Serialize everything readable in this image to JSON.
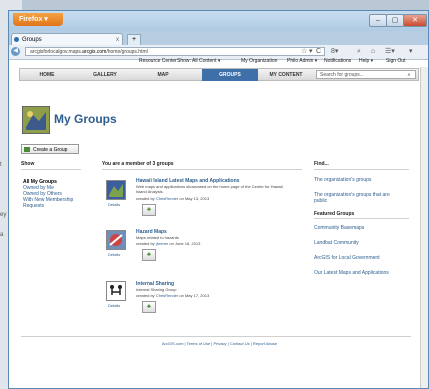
{
  "browser": {
    "menu_label": "Firefox ▾",
    "window_controls": [
      "–",
      "▢",
      "✕"
    ],
    "tab_title": "Groups",
    "tab_close": "x",
    "new_tab": "+",
    "url_host": "arcgisforlocalgov.maps.",
    "url_domain": "arcgis.com",
    "url_path": "/home/groups.html",
    "nav_icons": [
      "☆",
      "▾",
      "C",
      "8▾",
      "⌕",
      "⌂",
      "☰▾",
      "▾"
    ]
  },
  "topnav": {
    "resource_center": "Resource Center",
    "show_all": "Show: All Content ▾",
    "my_org": "My Organization",
    "user_admin": "Philo Admin ▾",
    "notifications": "Notifications",
    "help": "Help ▾",
    "sign_out": "Sign Out"
  },
  "mainnav": {
    "items": [
      "HOME",
      "GALLERY",
      "MAP",
      "GROUPS",
      "MY CONTENT"
    ],
    "active": "GROUPS",
    "search_placeholder": "Search for groups..."
  },
  "page": {
    "title": "My Groups",
    "create_button": "Create a Group",
    "show_heading": "Show",
    "member_heading": "You are a member of 3 groups",
    "find_heading": "Find..."
  },
  "show_items": [
    {
      "label": "All My Groups",
      "selected": true
    },
    {
      "label": "Owned by Me",
      "selected": false
    },
    {
      "label": "Owned by Others",
      "selected": false
    },
    {
      "label": "With New Membership Requests",
      "selected": false
    }
  ],
  "groups": [
    {
      "title": "Hawaii Island Latest Maps and Applications",
      "desc": "Web maps and applications showcased on the home page of the Center for Hawaii Island Analysis.",
      "created_prefix": "created by",
      "owner": "ChrisRender",
      "created_suffix": "on May 13, 2013",
      "details": "Details",
      "thumb_color": "#3a5ea0"
    },
    {
      "title": "Hazard Maps",
      "desc": "Maps related to hazards",
      "created_prefix": "created by",
      "owner": "jbrener",
      "created_suffix": "on June 18, 2013",
      "details": "Details",
      "thumb_color": "#6f8fb8"
    },
    {
      "title": "Internal Sharing",
      "desc": "Internal Sharing Group",
      "created_prefix": "created by",
      "owner": "ChrisRender",
      "created_suffix": "on May 17, 2013",
      "details": "Details",
      "thumb_color": "#ffffff"
    }
  ],
  "find": {
    "links": [
      "The organization's groups",
      "The organization's groups that are public"
    ],
    "featured_heading": "Featured Groups",
    "featured": [
      "Community Basemaps",
      "Landbat Community",
      "ArcGIS for Local Government",
      "Our Latest Maps and Applications"
    ]
  },
  "footer": {
    "links": [
      "ArcGIS.com",
      "Terms of Use",
      "Privacy",
      "Contact Us",
      "Report Abuse"
    ],
    "sep": " | "
  },
  "desktop": {
    "side_glyphs": [
      "t",
      "ey",
      "a"
    ]
  },
  "colors": {
    "accent": "#3f6fa9",
    "link": "#2c5e8f",
    "firefox": "#e0741a"
  }
}
